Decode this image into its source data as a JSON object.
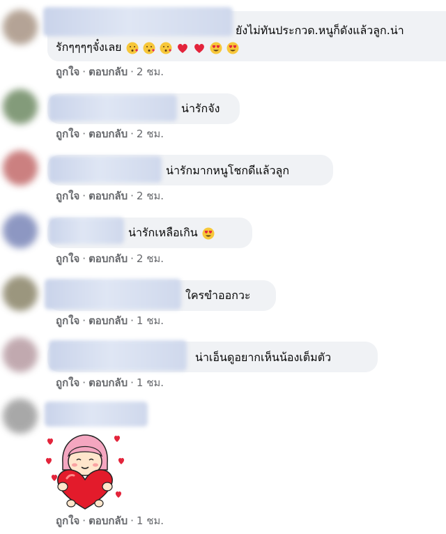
{
  "actions": {
    "like": "ถูกใจ",
    "reply": "ตอบกลับ",
    "separator": "·"
  },
  "comments": [
    {
      "text_line1": "ยังไม่ทันประกวด.หนูก็ดังแล้วลูก.น่า",
      "text_line2": "รักๆๆๆๆจั๋งเลย",
      "emojis": [
        "kiss",
        "kiss",
        "kiss",
        "heart",
        "heart",
        "heart-eyes",
        "heart-eyes"
      ],
      "time": "2 ชม.",
      "avatar_color": "#a89484"
    },
    {
      "text": "น่ารักจัง",
      "emojis": [],
      "time": "2 ชม.",
      "avatar_color": "#6e8a63"
    },
    {
      "text": "น่ารักมากหนูโชกดีแล้วลูก",
      "emojis": [],
      "time": "2 ชม.",
      "avatar_color": "#c26a6a"
    },
    {
      "text": "น่ารักเหลือเกิน",
      "emojis": [
        "heart-eyes"
      ],
      "time": "2 ชม.",
      "avatar_color": "#7a86b8"
    },
    {
      "text": "ใครขำออกวะ",
      "emojis": [],
      "time": "1 ชม.",
      "avatar_color": "#8a8468"
    },
    {
      "text": "น่าเอ็นดูอยากเห็นน้องเต็มตัว",
      "emojis": [],
      "time": "1 ชม.",
      "avatar_color": "#b79ba2"
    },
    {
      "sticker": "girl-holding-heart-sticker",
      "time": "1 ชม.",
      "avatar_color": "#9a9a9a"
    }
  ]
}
